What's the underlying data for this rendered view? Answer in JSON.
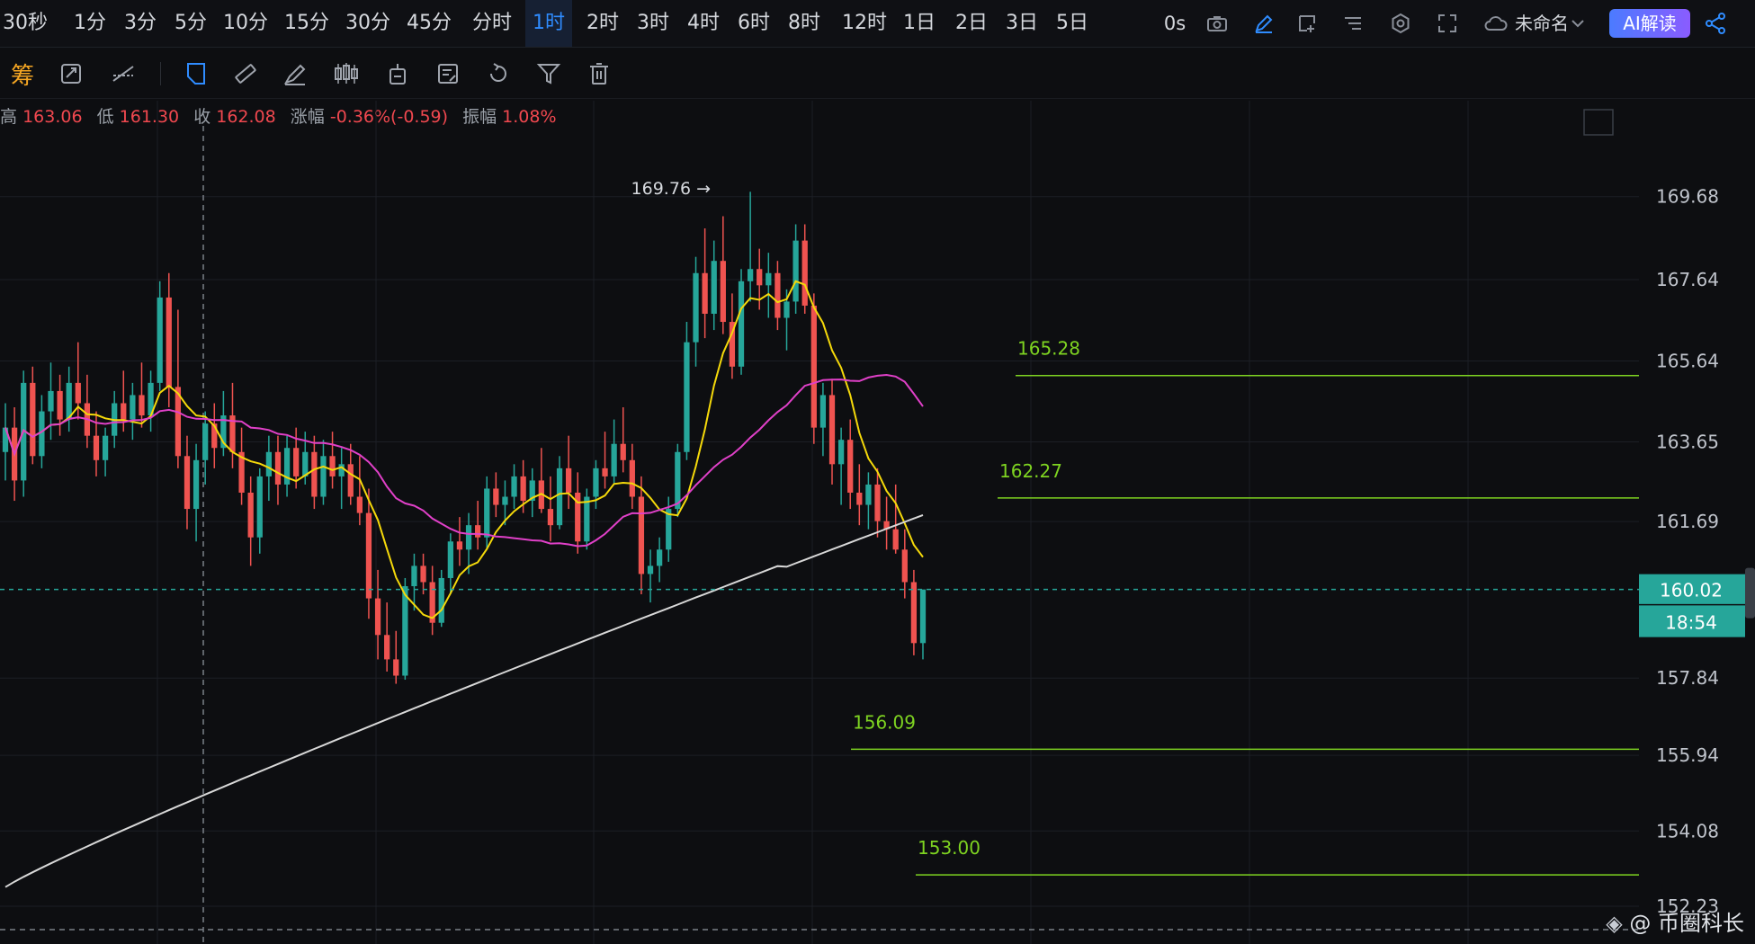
{
  "timeframes": [
    "30秒",
    "1分",
    "3分",
    "5分",
    "10分",
    "15分",
    "30分",
    "45分",
    "分时",
    "1时",
    "2时",
    "3时",
    "4时",
    "6时",
    "8时",
    "12时",
    "1日",
    "2日",
    "3日",
    "5日"
  ],
  "active_timeframe": "1时",
  "toolbar": {
    "countdown_label": "0s",
    "layout_name": "未命名",
    "ai_button": "AI解读"
  },
  "chips_label": "筹",
  "ohlc": {
    "high_label": "高",
    "high": "163.06",
    "low_label": "低",
    "low": "161.30",
    "close_label": "收",
    "close": "162.08",
    "change_label": "涨幅",
    "change": "-0.36%(-0.59)",
    "amplitude_label": "振幅",
    "amplitude": "1.08%"
  },
  "colors": {
    "up": "#26a69a",
    "down": "#ef5350",
    "level": "#7ed321",
    "ma_short": "#f5d90a",
    "ma_mid": "#e040c8",
    "ma_long": "#d8d8d8",
    "price_tag": "#26a69a"
  },
  "chart_data": {
    "type": "candlestick",
    "symbol": "",
    "interval": "1时",
    "y_axis_ticks": [
      169.68,
      167.64,
      165.64,
      163.65,
      161.69,
      157.84,
      155.94,
      154.08,
      152.23
    ],
    "ylim": [
      151.3,
      171.2
    ],
    "current_price": "160.02",
    "countdown": "18:54",
    "high_marker": "169.76",
    "levels": [
      {
        "label": "165.28",
        "value": 165.28
      },
      {
        "label": "162.27",
        "value": 162.27
      },
      {
        "label": "156.09",
        "value": 156.09
      },
      {
        "label": "153.00",
        "value": 153.0
      }
    ],
    "candles": [
      [
        163.4,
        164.6,
        162.7,
        164.0
      ],
      [
        164.0,
        164.5,
        162.2,
        162.7
      ],
      [
        162.7,
        165.4,
        162.3,
        165.1
      ],
      [
        165.1,
        165.5,
        163.1,
        163.3
      ],
      [
        163.3,
        164.8,
        163.0,
        164.4
      ],
      [
        164.4,
        165.6,
        163.7,
        164.9
      ],
      [
        164.9,
        165.3,
        163.8,
        164.2
      ],
      [
        164.2,
        165.5,
        163.9,
        165.1
      ],
      [
        165.1,
        166.1,
        164.2,
        164.6
      ],
      [
        164.6,
        165.3,
        163.5,
        163.8
      ],
      [
        163.8,
        164.4,
        162.8,
        163.2
      ],
      [
        163.2,
        164.0,
        162.8,
        163.8
      ],
      [
        163.8,
        164.9,
        163.5,
        164.6
      ],
      [
        164.6,
        165.4,
        163.9,
        164.2
      ],
      [
        164.2,
        165.1,
        163.7,
        164.8
      ],
      [
        164.8,
        165.6,
        164.0,
        164.3
      ],
      [
        164.3,
        165.4,
        163.9,
        165.1
      ],
      [
        165.1,
        167.6,
        164.9,
        167.2
      ],
      [
        167.2,
        167.8,
        164.5,
        165.0
      ],
      [
        165.0,
        166.9,
        163.0,
        163.3
      ],
      [
        163.3,
        163.8,
        161.5,
        162.0
      ],
      [
        162.0,
        163.6,
        161.2,
        163.2
      ],
      [
        163.2,
        164.4,
        162.6,
        164.1
      ],
      [
        164.1,
        164.6,
        163.0,
        163.5
      ],
      [
        163.5,
        164.9,
        163.3,
        164.3
      ],
      [
        164.3,
        165.1,
        163.0,
        163.4
      ],
      [
        163.4,
        164.0,
        162.1,
        162.4
      ],
      [
        162.4,
        162.8,
        160.6,
        161.3
      ],
      [
        161.3,
        163.0,
        160.9,
        162.8
      ],
      [
        162.8,
        163.8,
        162.2,
        163.4
      ],
      [
        163.4,
        163.8,
        162.1,
        162.6
      ],
      [
        162.6,
        163.8,
        162.3,
        163.5
      ],
      [
        163.5,
        164.0,
        162.5,
        162.8
      ],
      [
        162.8,
        163.9,
        162.6,
        163.4
      ],
      [
        163.4,
        163.8,
        162.0,
        162.3
      ],
      [
        162.3,
        163.7,
        162.1,
        163.3
      ],
      [
        163.3,
        163.9,
        162.5,
        162.8
      ],
      [
        162.8,
        163.5,
        162.0,
        163.1
      ],
      [
        163.1,
        163.6,
        162.1,
        162.3
      ],
      [
        162.3,
        163.3,
        161.6,
        161.9
      ],
      [
        161.9,
        162.5,
        159.3,
        159.8
      ],
      [
        159.8,
        160.5,
        158.3,
        158.9
      ],
      [
        158.9,
        159.7,
        158.0,
        158.3
      ],
      [
        158.3,
        159.0,
        157.7,
        157.9
      ],
      [
        157.9,
        160.3,
        157.8,
        160.1
      ],
      [
        160.1,
        160.9,
        159.5,
        160.6
      ],
      [
        160.6,
        160.9,
        159.9,
        160.2
      ],
      [
        160.2,
        160.6,
        158.9,
        159.2
      ],
      [
        159.2,
        160.5,
        159.1,
        160.3
      ],
      [
        160.3,
        161.4,
        159.9,
        161.2
      ],
      [
        161.2,
        161.8,
        160.6,
        161.0
      ],
      [
        161.0,
        161.9,
        160.4,
        161.6
      ],
      [
        161.6,
        162.2,
        161.0,
        161.3
      ],
      [
        161.3,
        162.8,
        161.0,
        162.5
      ],
      [
        162.5,
        162.9,
        161.8,
        162.1
      ],
      [
        162.1,
        162.7,
        161.6,
        162.3
      ],
      [
        162.3,
        163.1,
        162.0,
        162.8
      ],
      [
        162.8,
        163.2,
        161.9,
        162.2
      ],
      [
        162.2,
        163.0,
        161.8,
        162.7
      ],
      [
        162.7,
        163.5,
        161.9,
        162.0
      ],
      [
        162.0,
        162.8,
        161.2,
        161.6
      ],
      [
        161.6,
        163.3,
        161.5,
        163.0
      ],
      [
        163.0,
        163.8,
        162.0,
        162.4
      ],
      [
        162.4,
        162.9,
        160.9,
        161.2
      ],
      [
        161.2,
        162.5,
        161.0,
        162.3
      ],
      [
        162.3,
        163.2,
        162.0,
        163.0
      ],
      [
        163.0,
        163.9,
        162.5,
        162.8
      ],
      [
        162.8,
        164.2,
        162.6,
        163.6
      ],
      [
        163.6,
        164.5,
        162.9,
        163.2
      ],
      [
        163.2,
        163.6,
        162.0,
        162.3
      ],
      [
        162.3,
        162.8,
        159.9,
        160.4
      ],
      [
        160.4,
        161.0,
        159.7,
        160.6
      ],
      [
        160.6,
        161.3,
        160.2,
        161.0
      ],
      [
        161.0,
        162.3,
        160.7,
        162.0
      ],
      [
        162.0,
        163.6,
        161.8,
        163.4
      ],
      [
        163.4,
        166.6,
        163.2,
        166.1
      ],
      [
        166.1,
        168.2,
        165.5,
        167.8
      ],
      [
        167.8,
        168.9,
        166.2,
        166.8
      ],
      [
        166.8,
        168.6,
        166.4,
        168.1
      ],
      [
        168.1,
        169.2,
        166.3,
        166.6
      ],
      [
        166.6,
        167.3,
        165.2,
        165.5
      ],
      [
        165.5,
        167.9,
        165.3,
        167.6
      ],
      [
        167.6,
        169.8,
        167.1,
        167.9
      ],
      [
        167.9,
        168.4,
        166.9,
        167.5
      ],
      [
        167.5,
        168.3,
        166.7,
        167.8
      ],
      [
        167.8,
        168.1,
        166.4,
        166.7
      ],
      [
        166.7,
        167.4,
        165.9,
        167.1
      ],
      [
        167.1,
        169.0,
        166.8,
        168.6
      ],
      [
        168.6,
        169.0,
        166.8,
        167.0
      ],
      [
        167.0,
        167.3,
        163.6,
        164.0
      ],
      [
        164.0,
        165.1,
        163.3,
        164.8
      ],
      [
        164.8,
        165.2,
        162.6,
        163.1
      ],
      [
        163.1,
        164.0,
        162.1,
        163.7
      ],
      [
        163.7,
        164.2,
        162.0,
        162.4
      ],
      [
        162.4,
        163.1,
        161.6,
        162.1
      ],
      [
        162.1,
        162.9,
        161.5,
        162.6
      ],
      [
        162.6,
        163.0,
        161.3,
        161.7
      ],
      [
        161.7,
        162.3,
        161.0,
        161.5
      ],
      [
        161.5,
        162.6,
        160.9,
        161.0
      ],
      [
        161.0,
        161.5,
        159.8,
        160.2
      ],
      [
        160.2,
        160.5,
        158.4,
        158.7
      ],
      [
        158.7,
        159.2,
        158.3,
        160.02
      ]
    ]
  }
}
